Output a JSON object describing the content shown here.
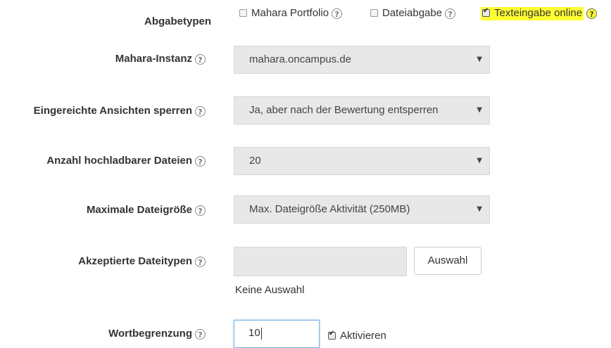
{
  "assignment_types": {
    "label": "Abgabetypen",
    "options": [
      {
        "label": "Mahara Portfolio",
        "checked": false
      },
      {
        "label": "Dateiabgabe",
        "checked": false
      },
      {
        "label": "Texteingabe online",
        "checked": true,
        "highlighted": true
      }
    ]
  },
  "mahara_instance": {
    "label": "Mahara-Instanz",
    "value": "mahara.oncampus.de"
  },
  "lock_views": {
    "label": "Eingereichte Ansichten sperren",
    "value": "Ja, aber nach der Bewertung entsperren"
  },
  "max_files": {
    "label": "Anzahl hochladbarer Dateien",
    "value": "20"
  },
  "max_file_size": {
    "label": "Maximale Dateigröße",
    "value": "Max. Dateigröße Aktivität (250MB)"
  },
  "accepted_types": {
    "label": "Akzeptierte Dateitypen",
    "value": "",
    "button_label": "Auswahl",
    "status": "Keine Auswahl"
  },
  "word_limit": {
    "label": "Wortbegrenzung",
    "value": "10",
    "enable_label": "Aktivieren",
    "enabled": true
  },
  "icons": {
    "help": "question-circle-icon",
    "dropdown": "caret-down-icon",
    "checkbox": "checkbox-icon"
  },
  "colors": {
    "highlight": "#ffff33",
    "field_bg": "#e8e8e8"
  }
}
